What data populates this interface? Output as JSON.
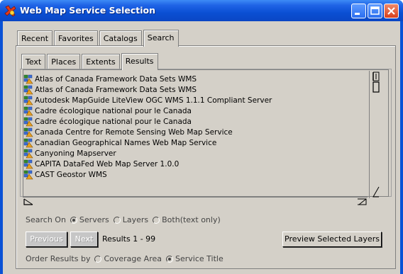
{
  "window": {
    "title": "Web Map Service Selection",
    "accent_color": "#0a52d6"
  },
  "main_tabs": [
    {
      "label": "Recent",
      "active": false
    },
    {
      "label": "Favorites",
      "active": false
    },
    {
      "label": "Catalogs",
      "active": false
    },
    {
      "label": "Search",
      "active": true
    }
  ],
  "sub_tabs": [
    {
      "label": "Text",
      "active": false
    },
    {
      "label": "Places",
      "active": false
    },
    {
      "label": "Extents",
      "active": false
    },
    {
      "label": "Results",
      "active": true
    }
  ],
  "results": {
    "items": [
      "Atlas of Canada Framework Data Sets WMS",
      "Atlas of Canada Framework Data Sets WMS",
      "Autodesk MapGuide LiteView OGC WMS 1.1.1 Compliant Server",
      "Cadre écologique national pour le Canada",
      "Cadre écologique national pour le Canada",
      "Canada Centre for Remote Sensing Web Map Service",
      "Canadian Geographical Names Web Map Service",
      "Canyoning Mapserver",
      "CAPITA DataFed Web Map Server 1.0.0",
      "CAST Geostor WMS"
    ],
    "item_icon": "globe-layers-icon"
  },
  "search_on": {
    "label": "Search On",
    "options": [
      {
        "label": "Servers",
        "selected": true
      },
      {
        "label": "Layers",
        "selected": false
      },
      {
        "label": "Both(text only)",
        "selected": false
      }
    ]
  },
  "paging": {
    "previous_label": "Previous",
    "next_label": "Next",
    "results_range": "Results 1 - 99",
    "preview_label": "Preview Selected Layers"
  },
  "order_by": {
    "label": "Order Results by",
    "options": [
      {
        "label": "Coverage Area",
        "selected": false
      },
      {
        "label": "Service Title",
        "selected": true
      }
    ]
  }
}
